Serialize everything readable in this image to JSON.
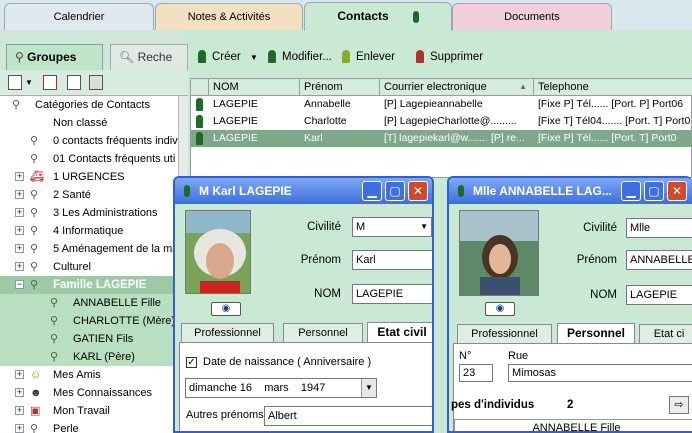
{
  "tabs": [
    "Calendrier",
    "Notes & Activités",
    "Contacts",
    "Documents"
  ],
  "left_panel": {
    "tabs": [
      "Groupes",
      "Reche"
    ],
    "tree": [
      {
        "label": "Catégories de Contacts",
        "level": 0,
        "icon": "group-icon"
      },
      {
        "label": "Non classé",
        "level": 1,
        "icon": ""
      },
      {
        "label": "0 contacts fréquents indiv",
        "level": 1,
        "icon": "group-icon"
      },
      {
        "label": "01 Contacts  fréquents uti",
        "level": 1,
        "icon": "group-icon"
      },
      {
        "label": "1 URGENCES",
        "level": 1,
        "icon": "ambulance-icon",
        "expand": "+"
      },
      {
        "label": "2 Santé",
        "level": 1,
        "icon": "group-icon",
        "expand": "+"
      },
      {
        "label": "3  Les Administrations",
        "level": 1,
        "icon": "group-icon",
        "expand": "+"
      },
      {
        "label": "4 Informatique",
        "level": 1,
        "icon": "group-icon",
        "expand": "+"
      },
      {
        "label": "5 Aménagement de la ma",
        "level": 1,
        "icon": "group-icon",
        "expand": "+"
      },
      {
        "label": "Culturel",
        "level": 1,
        "icon": "group-icon",
        "expand": "+"
      },
      {
        "label": "Famille LAGEPIE",
        "level": 1,
        "icon": "group-icon",
        "expand": "−",
        "selected": true
      },
      {
        "label": "ANNABELLE Fille",
        "level": 2,
        "icon": "person-icon"
      },
      {
        "label": "CHARLOTTE (Mère)",
        "level": 2,
        "icon": "person-icon"
      },
      {
        "label": "GATIEN Fils",
        "level": 2,
        "icon": "person-icon"
      },
      {
        "label": "KARL  (Père)",
        "level": 2,
        "icon": "person-icon"
      },
      {
        "label": "Mes Amis",
        "level": 1,
        "icon": "friends-icon",
        "expand": "+"
      },
      {
        "label": "Mes Connaissances",
        "level": 1,
        "icon": "people-icon",
        "expand": "+"
      },
      {
        "label": "Mon Travail",
        "level": 1,
        "icon": "work-icon",
        "expand": "+"
      },
      {
        "label": "Perle",
        "level": 1,
        "icon": "group-icon",
        "expand": "+"
      }
    ]
  },
  "toolbar": {
    "create": "Créer",
    "modify": "Modifier...",
    "remove": "Enlever",
    "delete": "Supprimer"
  },
  "grid": {
    "columns": [
      "NOM",
      "Prénom",
      "Courrier electronique",
      "Telephone"
    ],
    "rows": [
      [
        "LAGEPIE",
        "Annabelle",
        "[P] Lagepieannabelle",
        "[Fixe P] Tél......  [Port. P] Port06"
      ],
      [
        "LAGEPIE",
        "Charlotte",
        "[P] LagepieCharlotte@.........",
        "[Fixe T] Tél04.......  [Port. T] Port0"
      ],
      [
        "LAGEPIE",
        "Karl",
        "[T] lagepiekarl@w.......  [P] re...",
        "[Fixe P] Tél......  [Port. T] Port0"
      ]
    ]
  },
  "card1": {
    "title": "M Karl LAGEPIE",
    "civilite_label": "Civilité",
    "civilite": "M",
    "prenom_label": "Prénom",
    "prenom": "Karl",
    "nom_label": "NOM",
    "nom": "LAGEPIE",
    "tabs": [
      "Professionnel",
      "Personnel",
      "Etat civil"
    ],
    "dob_label": "Date de naissance ( Anniversaire )",
    "dob_day": "dimanche 16",
    "dob_month": "mars",
    "dob_year": "1947",
    "other_label": "Autres prénoms",
    "other": "Albert"
  },
  "card2": {
    "title": "Mlle ANNABELLE LAG...",
    "civilite_label": "Civilité",
    "civilite": "Mlle",
    "prenom_label": "Prénom",
    "prenom": "ANNABELLE",
    "nom_label": "NOM",
    "nom": "LAGEPIE",
    "tabs": [
      "Professionnel",
      "Personnel",
      "Etat ci"
    ],
    "no_label": "N°",
    "no": "23",
    "rue_label": "Rue",
    "rue": "Mimosas",
    "groups_label": "pes d'individus",
    "groups_count": "2",
    "groups_first": "ANNABELLE Fille"
  }
}
